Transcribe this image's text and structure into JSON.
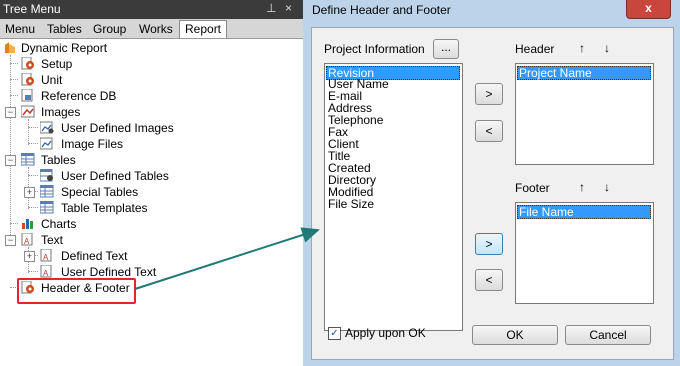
{
  "tree_menu": {
    "title": "Tree Menu",
    "pin_glyph": "⊥",
    "close_glyph": "×",
    "tabs": [
      "Menu",
      "Tables",
      "Group",
      "Works",
      "Report"
    ],
    "active_tab": "Report",
    "nodes": {
      "dynamic_report": "Dynamic Report",
      "setup": "Setup",
      "unit": "Unit",
      "reference_db": "Reference DB",
      "images": "Images",
      "user_defined_images": "User Defined Images",
      "image_files": "Image Files",
      "tables": "Tables",
      "user_defined_tables": "User Defined Tables",
      "special_tables": "Special Tables",
      "table_templates": "Table Templates",
      "charts": "Charts",
      "text": "Text",
      "defined_text": "Defined Text",
      "user_defined_text": "User Defined Text",
      "header_footer": "Header & Footer"
    },
    "collapse_glyph": "−",
    "expand_glyph": "+"
  },
  "dialog": {
    "title": "Define Header and Footer",
    "close_glyph": "x",
    "project_info_label": "Project Information",
    "browse_label": "...",
    "project_items": [
      "Revision",
      "User Name",
      "E-mail",
      "Address",
      "Telephone",
      "Fax",
      "Client",
      "Title",
      "Created",
      "Directory",
      "Modified",
      "File Size"
    ],
    "project_selected": "Revision",
    "header_label": "Header",
    "header_items": [
      "Project Name"
    ],
    "footer_label": "Footer",
    "footer_items": [
      "File Name"
    ],
    "up_arrow": "↑",
    "down_arrow": "↓",
    "add_glyph": ">",
    "remove_glyph": "<",
    "apply_label": "Apply upon OK",
    "apply_checked": "✓",
    "ok_label": "OK",
    "cancel_label": "Cancel"
  },
  "colors": {
    "dialog_frame": "#bcd3ea",
    "selection": "#3399ff",
    "highlight_box": "#e02828",
    "connector_arrow": "#1f7a78"
  }
}
